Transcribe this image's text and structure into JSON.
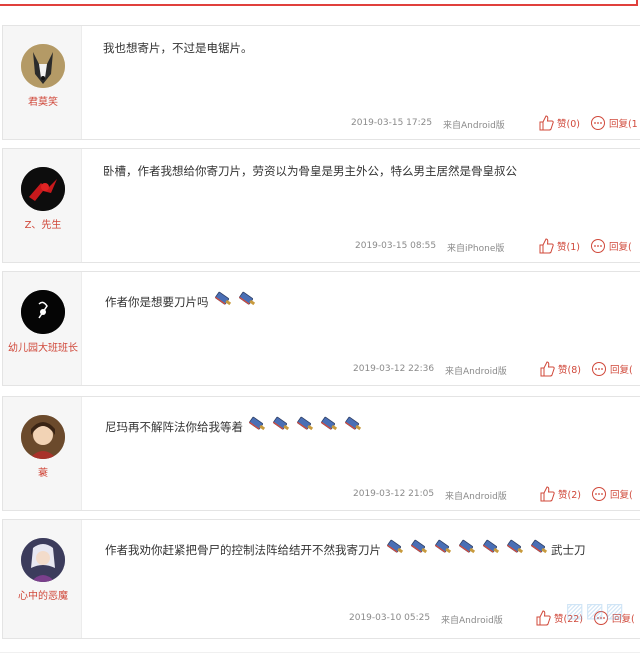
{
  "comments": [
    {
      "username": "君莫笑",
      "text": "我也想寄片，不过是电锯片。",
      "emoji_count": 0,
      "trailing_text": "",
      "time": "2019-03-15 17:25",
      "source": "来自Android版",
      "like_label": "赞(0)",
      "reply_label": "回复(1"
    },
    {
      "username": "Z、先生",
      "text": "卧槽，作者我想给你寄刀片，劳资以为骨皇是男主外公，特么男主居然是骨皇叔公",
      "emoji_count": 0,
      "trailing_text": "",
      "time": "2019-03-15 08:55",
      "source": "来自iPhone版",
      "like_label": "赞(1)",
      "reply_label": "回复("
    },
    {
      "username": "幼儿园大班班长",
      "text": "作者你是想要刀片吗",
      "emoji_count": 2,
      "trailing_text": "",
      "time": "2019-03-12 22:36",
      "source": "来自Android版",
      "like_label": "赞(8)",
      "reply_label": "回复("
    },
    {
      "username": "蓑",
      "text": "尼玛再不解阵法你给我等着",
      "emoji_count": 5,
      "trailing_text": "",
      "time": "2019-03-12 21:05",
      "source": "来自Android版",
      "like_label": "赞(2)",
      "reply_label": "回复("
    },
    {
      "username": "心中的恶魔",
      "text": "作者我劝你赶紧把骨尸的控制法阵给结开不然我寄刀片",
      "emoji_count": 7,
      "trailing_text": "武士刀",
      "time": "2019-03-10 05:25",
      "source": "来自Android版",
      "like_label": "赞(22)",
      "reply_label": "回复("
    }
  ],
  "colors": {
    "accent": "#d0483a",
    "top_border": "#e0403c",
    "sidebar_bg": "#f6f6f6",
    "meta_text": "#8a8a8a"
  },
  "icons": {
    "like": "thumbs-up-icon",
    "reply": "speech-bubble-icon",
    "emoji": "knife-emoji-icon"
  }
}
